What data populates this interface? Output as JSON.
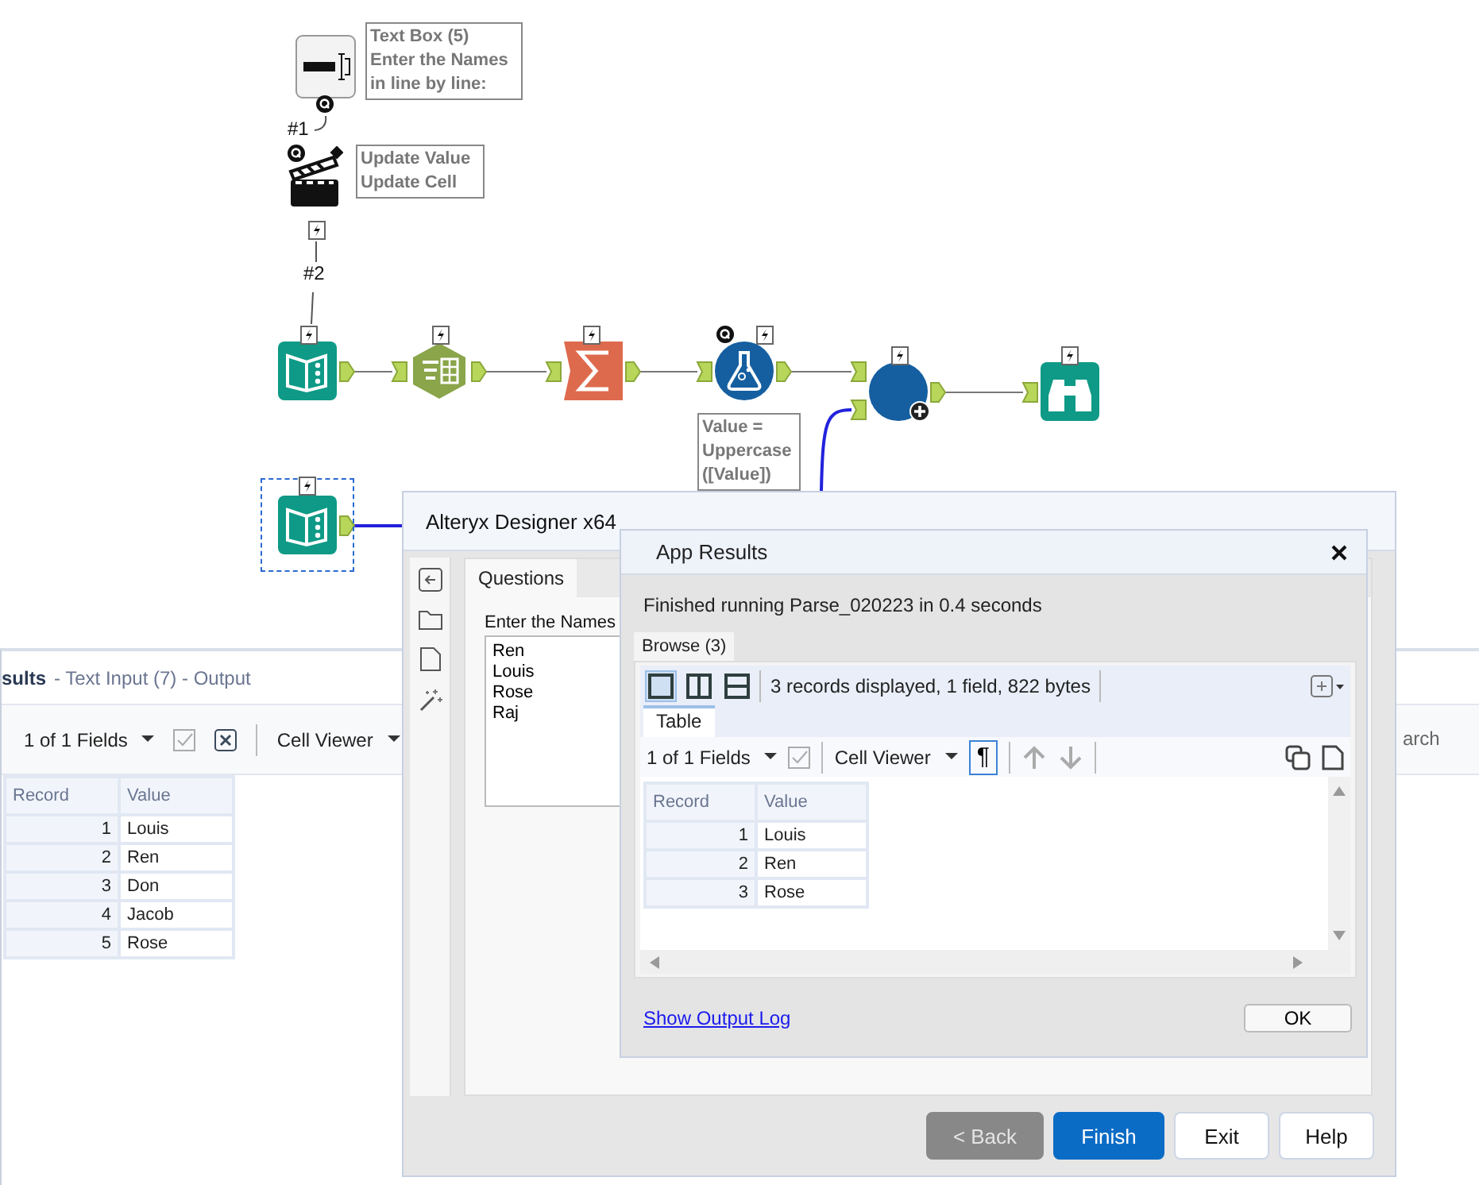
{
  "canvas": {
    "tools": [
      {
        "kind": "textbox",
        "question": true,
        "selected": false
      },
      {
        "kind": "action",
        "question": true,
        "selected": false
      },
      {
        "kind": "input",
        "question": false,
        "selected": false
      },
      {
        "kind": "table",
        "question": false,
        "selected": false
      },
      {
        "kind": "summarize",
        "question": false,
        "selected": false
      },
      {
        "kind": "formula",
        "question": true,
        "selected": false
      },
      {
        "kind": "join",
        "question": false,
        "selected": false
      },
      {
        "kind": "browse",
        "question": false,
        "selected": false
      },
      {
        "kind": "input",
        "question": false,
        "selected": true
      }
    ],
    "annotations": [
      [
        "Text Box (5)",
        "Enter the Names",
        "in line by line:"
      ],
      [
        "Update Value",
        "Update Cell"
      ],
      [
        "Value =",
        "Uppercase",
        "([Value])"
      ]
    ],
    "connection_labels": [
      "#1",
      "#2"
    ]
  },
  "results_panel": {
    "title": "sults",
    "subtitle": "- Text Input (7) - Output",
    "fields_dropdown": "1 of 1 Fields",
    "viewer_dropdown": "Cell Viewer",
    "search": {
      "placeholder": "arch"
    },
    "columns": [
      "Record",
      "Value"
    ],
    "rows": [
      [
        "1",
        "Louis"
      ],
      [
        "2",
        "Ren"
      ],
      [
        "3",
        "Don"
      ],
      [
        "4",
        "Jacob"
      ],
      [
        "5",
        "Rose"
      ]
    ]
  },
  "designer_window": {
    "title": "Alteryx Designer x64",
    "tabs": [
      {
        "label": "Questions",
        "selected": true
      }
    ],
    "question_label": "Enter the Names",
    "names_value": "Ren\nLouis\nRose\nRaj",
    "buttons": [
      {
        "label": "< Back",
        "disabled": true,
        "primary": false
      },
      {
        "label": "Finish",
        "disabled": false,
        "primary": true
      },
      {
        "label": "Exit",
        "disabled": false,
        "primary": false
      },
      {
        "label": "Help",
        "disabled": false,
        "primary": false
      }
    ]
  },
  "app_results": {
    "title": "App Results",
    "status": "Finished running Parse_020223 in 0.4 seconds",
    "tabs": [
      {
        "label": "Browse (3)",
        "selected": true
      }
    ],
    "layout_modes": [
      {
        "kind": "single",
        "selected": true
      },
      {
        "kind": "columns",
        "selected": false
      },
      {
        "kind": "rows",
        "selected": false
      }
    ],
    "summary": "3 records displayed, 1 field, 822 bytes",
    "view_tabs": [
      {
        "label": "Table",
        "selected": true
      }
    ],
    "fields_dropdown": "1 of 1 Fields",
    "viewer_dropdown": "Cell Viewer",
    "pilcrow": {
      "label": "¶",
      "selected": true
    },
    "columns": [
      "Record",
      "Value"
    ],
    "rows": [
      [
        "1",
        "Louis"
      ],
      [
        "2",
        "Ren"
      ],
      [
        "3",
        "Rose"
      ]
    ],
    "link": "Show Output Log",
    "ok": "OK"
  }
}
